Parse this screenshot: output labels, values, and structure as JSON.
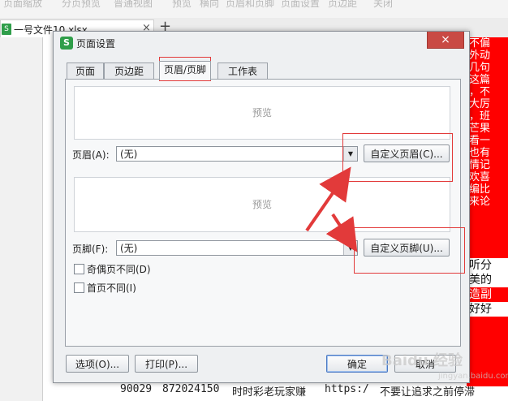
{
  "ribbon": {
    "items": [
      "页面缩放",
      "分页预览",
      "普通视图",
      "预览",
      "横向",
      "页眉和页脚",
      "页面设置",
      "页边距",
      "关闭"
    ]
  },
  "document_tab": {
    "name": "一号文件10.xlsx",
    "close": "×",
    "new_tab": "+"
  },
  "dialog": {
    "title": "页面设置",
    "close": "×",
    "logo": "S",
    "tabs": [
      {
        "label": "页面",
        "active": false
      },
      {
        "label": "页边距",
        "active": false
      },
      {
        "label": "页眉/页脚",
        "active": true
      },
      {
        "label": "工作表",
        "active": false
      }
    ],
    "header_preview": "预览",
    "header_label": "页眉(A):",
    "header_value": "(无)",
    "custom_header_button": "自定义页眉(C)...",
    "footer_preview": "预览",
    "footer_label": "页脚(F):",
    "footer_value": "(无)",
    "custom_footer_button": "自定义页脚(U)...",
    "odd_even_label": "奇偶页不同(D)",
    "first_page_label": "首页不同(I)",
    "options_button": "选项(O)...",
    "print_button": "打印(P)...",
    "ok_button": "确定",
    "cancel_button": "取消"
  },
  "sheet": {
    "red_column_text": [
      "不偏",
      "外动",
      "几句",
      "这篇",
      "，不",
      "大厉",
      "，班",
      "芒果",
      "看一",
      "也有",
      "情记",
      "欢喜",
      "编比",
      "来论"
    ],
    "white_cells": [
      "听分",
      "美的",
      "造副",
      "好好"
    ],
    "bottom_row": [
      "90029",
      "872024150",
      "时时彩老玩家赚",
      "https:/",
      "不要让追求之前停滞"
    ]
  },
  "watermark": {
    "text": "Baidu 经验",
    "sub": "jingyan.baidu.com"
  },
  "colors": {
    "highlight_red": "#ff0000",
    "annotation_red": "#e23a3a",
    "spreadsheet_green": "#2f9e4a"
  }
}
